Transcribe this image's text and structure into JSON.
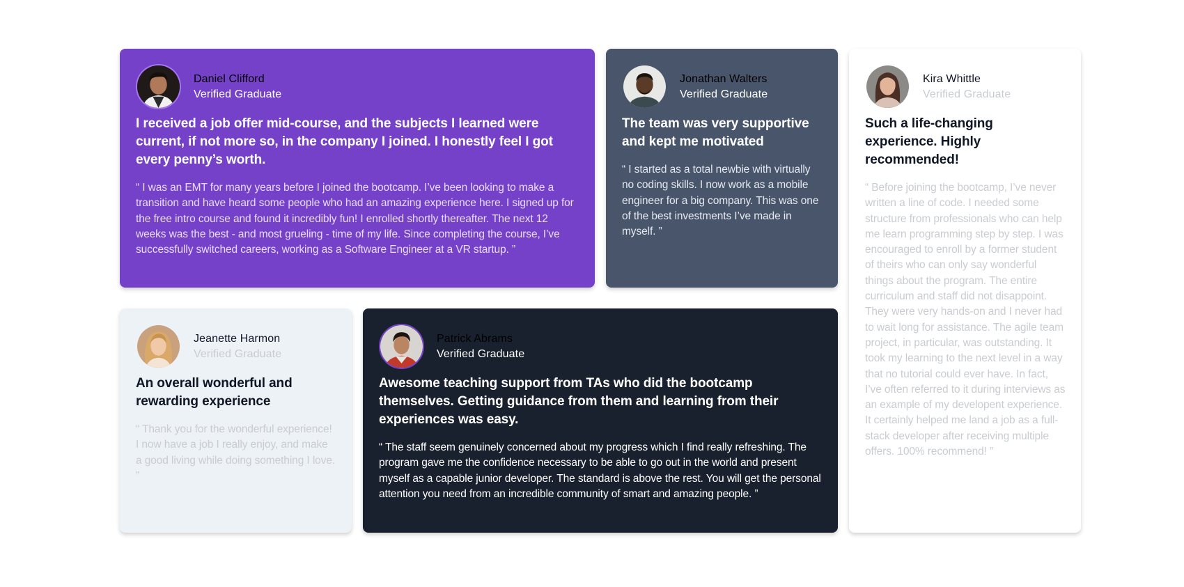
{
  "testimonials": [
    {
      "name": "Daniel Clifford",
      "role": "Verified Graduate",
      "headline": "I received a job offer mid-course, and the subjects I learned were current, if not more so, in the company I joined. I honestly feel I got every penny’s worth.",
      "quote": "“ I was an EMT for many years before I joined the bootcamp. I’ve been looking to make a transition and have heard some people who had an amazing experience here. I signed up for the free intro course and found it incredibly fun! I enrolled shortly thereafter. The next 12 weeks was the best - and most grueling - time of my life. Since completing the course, I’ve successfully switched careers, working as a Software Engineer at a VR startup. ”",
      "background": "#7541c8"
    },
    {
      "name": "Jonathan Walters",
      "role": "Verified Graduate",
      "headline": "The team was very supportive and kept me motivated",
      "quote": "“ I started as a total newbie with virtually no coding skills. I now work as a mobile engineer for a big company. This was one of the best investments I’ve made in myself. ”",
      "background": "#48556a"
    },
    {
      "name": "Kira Whittle",
      "role": "Verified Graduate",
      "headline": "Such a life-changing experience. Highly recommended!",
      "quote": "“ Before joining the bootcamp, I’ve never written a line of code. I needed some structure from professionals who can help me learn programming step by step. I was encouraged to enroll by a former student of theirs who can only say wonderful things about the program. The entire curriculum and staff did not disappoint. They were very hands-on and I never had to wait long for assistance. The agile team project, in particular, was outstanding. It took my learning to the next level in a way that no tutorial could ever have. In fact, I’ve often referred to it during interviews as an example of my developent experience. It certainly helped me land a job as a full-stack developer after receiving multiple offers. 100% recommend! ”",
      "background": "#ffffff"
    },
    {
      "name": "Jeanette Harmon",
      "role": "Verified Graduate",
      "headline": "An overall wonderful and rewarding experience",
      "quote": "“ Thank you for the wonderful experience! I now have a job I really enjoy, and make a good living while doing something I love. ”",
      "background": "#edf2f7"
    },
    {
      "name": "Patrick Abrams",
      "role": "Verified Graduate",
      "headline": "Awesome teaching support from TAs who did the bootcamp themselves. Getting guidance from them and learning from their experiences was easy.",
      "quote": "“ The staff seem genuinely concerned about my progress which I find really refreshing. The program gave me the confidence necessary to be able to go out in the world and present myself as a capable junior developer. The standard is above the rest. You will get the personal attention you need from an incredible community of smart and amazing people. ”",
      "background": "#19212e"
    }
  ]
}
